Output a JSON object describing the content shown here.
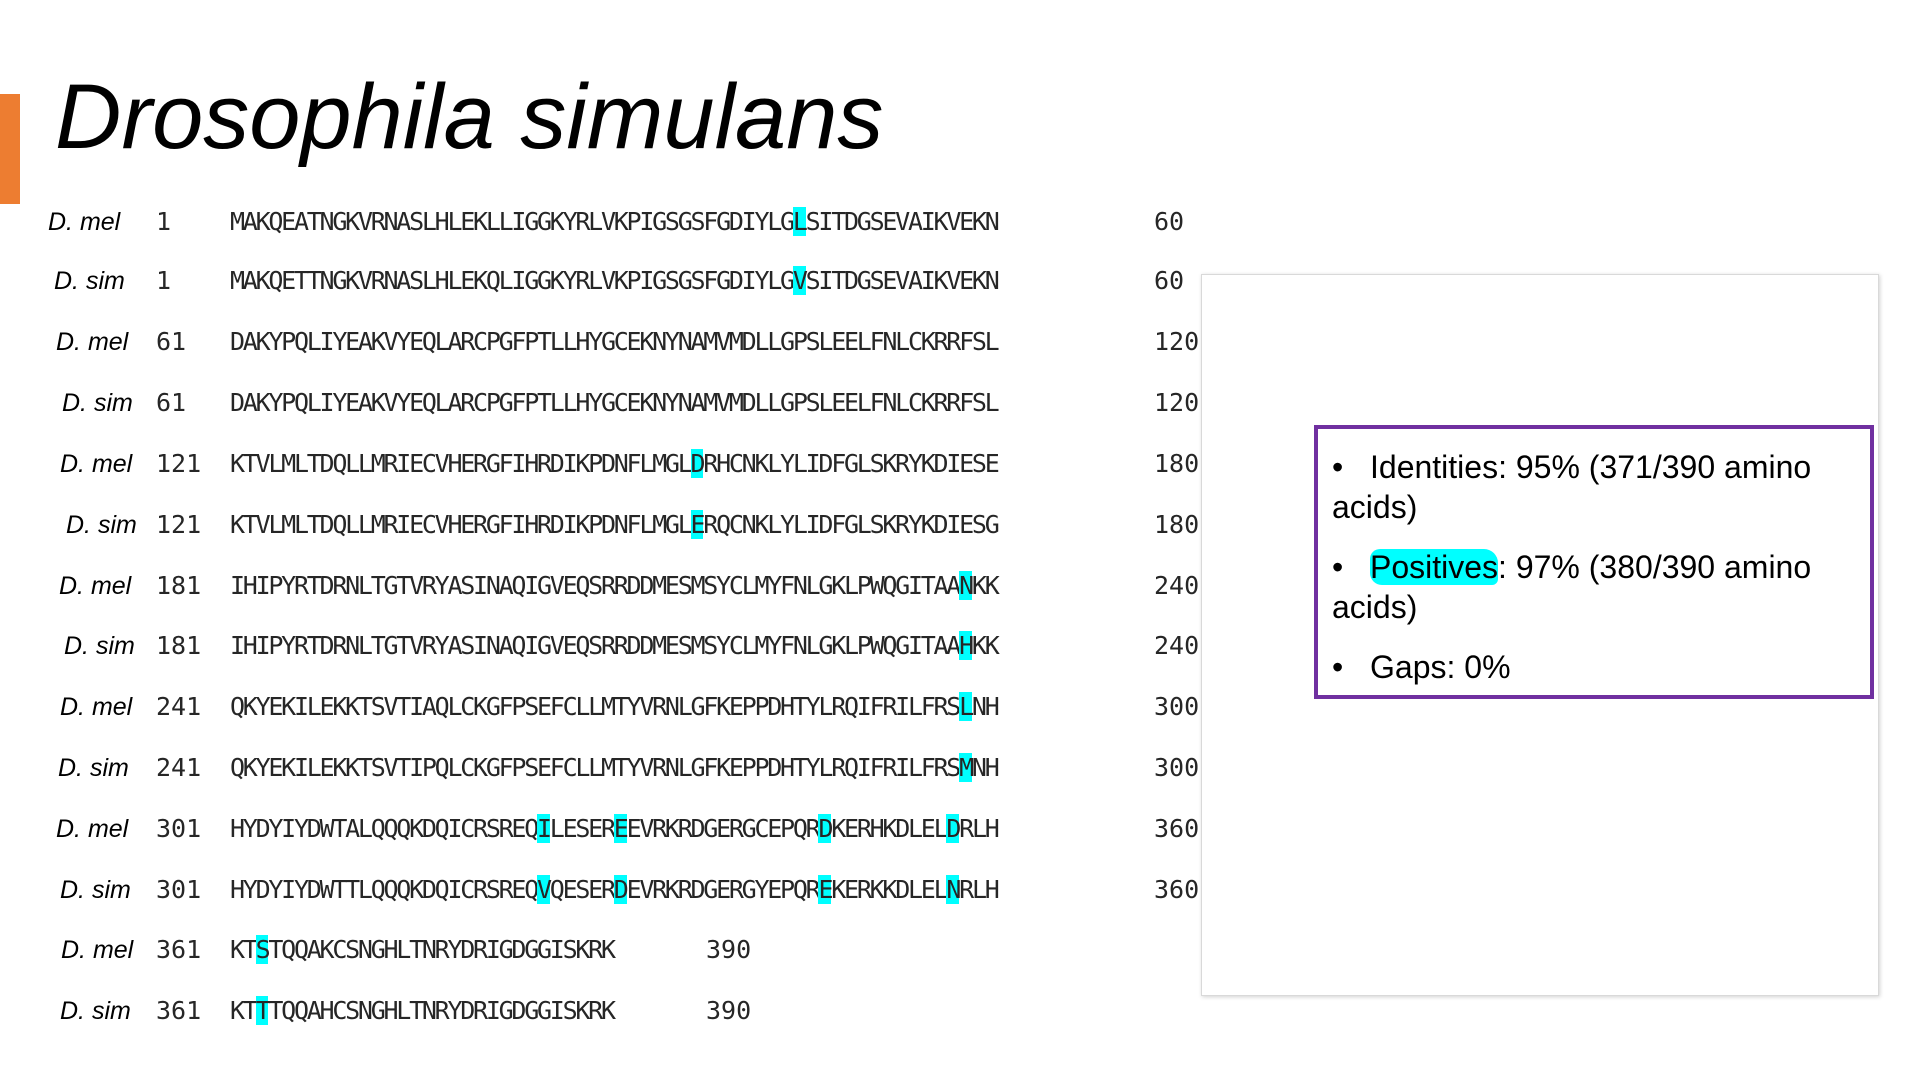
{
  "title": "Drosophila simulans",
  "alignment": [
    {
      "species": "D. mel",
      "start": "1",
      "end": "60",
      "segments": [
        {
          "t": "MAKQEATNGKVRNASLHLEKLLIGGKYRLVKPIGSGSFGDIYLG"
        },
        {
          "t": "L",
          "h": true
        },
        {
          "t": "SITDGSEVAIKVEKN"
        }
      ]
    },
    {
      "species": "D. sim",
      "start": "1",
      "end": "60",
      "segments": [
        {
          "t": "MAKQETTNGKVRNASLHLEKQLIGGKYRLVKPIGSGSFGDIYLG"
        },
        {
          "t": "V",
          "h": true
        },
        {
          "t": "SITDGSEVAIKVEKN"
        }
      ]
    },
    {
      "species": "D. mel",
      "start": "61",
      "end": "120",
      "segments": [
        {
          "t": "DAKYPQLIYEAKVYEQLARCPGFPTLLHYGCEKNYNAMVMDLLGPSLEELFNLCKRRFSL"
        }
      ]
    },
    {
      "species": "D. sim",
      "start": "61",
      "end": "120",
      "segments": [
        {
          "t": "DAKYPQLIYEAKVYEQLARCPGFPTLLHYGCEKNYNAMVMDLLGPSLEELFNLCKRRFSL"
        }
      ]
    },
    {
      "species": "D. mel",
      "start": "121",
      "end": "180",
      "segments": [
        {
          "t": "KTVLMLTDQLLMRIECVHERGFIHRDIKPDNFLMGL"
        },
        {
          "t": "D",
          "h": true
        },
        {
          "t": "RHCNKLYLIDFGLSKRYKDIESE"
        }
      ]
    },
    {
      "species": "D. sim",
      "start": "121",
      "end": "180",
      "segments": [
        {
          "t": "KTVLMLTDQLLMRIECVHERGFIHRDIKPDNFLMGL"
        },
        {
          "t": "E",
          "h": true
        },
        {
          "t": "RQCNKLYLIDFGLSKRYKDIESG"
        }
      ]
    },
    {
      "species": "D. mel",
      "start": "181",
      "end": "240",
      "segments": [
        {
          "t": "IHIPYRTDRNLTGTVRYASINAQIGVEQSRRDDMESMSYCLMYFNLGKLPWQGITAA"
        },
        {
          "t": "N",
          "h": true
        },
        {
          "t": "KK"
        }
      ]
    },
    {
      "species": "D. sim",
      "start": "181",
      "end": "240",
      "segments": [
        {
          "t": "IHIPYRTDRNLTGTVRYASINAQIGVEQSRRDDMESMSYCLMYFNLGKLPWQGITAA"
        },
        {
          "t": "H",
          "h": true
        },
        {
          "t": "KK"
        }
      ]
    },
    {
      "species": "D. mel",
      "start": "241",
      "end": "300",
      "segments": [
        {
          "t": "QKYEKILEKKTSVTIAQLCKGFPSEFCLLMTYVRNLGFKEPPDHTYLRQIFRILFRS"
        },
        {
          "t": "L",
          "h": true
        },
        {
          "t": "NH"
        }
      ]
    },
    {
      "species": "D. sim",
      "start": "241",
      "end": "300",
      "segments": [
        {
          "t": "QKYEKILEKKTSVTIPQLCKGFPSEFCLLMTYVRNLGFKEPPDHTYLRQIFRILFRS"
        },
        {
          "t": "M",
          "h": true
        },
        {
          "t": "NH"
        }
      ]
    },
    {
      "species": "D. mel",
      "start": "301",
      "end": "360",
      "segments": [
        {
          "t": "HYDYIYDWTALQQQKDQICRSREQ"
        },
        {
          "t": "I",
          "h": true
        },
        {
          "t": "LESER"
        },
        {
          "t": "E",
          "h": true
        },
        {
          "t": "EVRKRDGERGCEPQR"
        },
        {
          "t": "D",
          "h": true
        },
        {
          "t": "KERHKDLEL"
        },
        {
          "t": "D",
          "h": true
        },
        {
          "t": "RLH"
        }
      ]
    },
    {
      "species": "D. sim",
      "start": "301",
      "end": "360",
      "segments": [
        {
          "t": "HYDYIYDWTTLQQQKDQICRSREQ"
        },
        {
          "t": "V",
          "h": true
        },
        {
          "t": "QESER"
        },
        {
          "t": "D",
          "h": true
        },
        {
          "t": "EVRKRDGERGYEPQR"
        },
        {
          "t": "E",
          "h": true
        },
        {
          "t": "KERKKDLEL"
        },
        {
          "t": "N",
          "h": true
        },
        {
          "t": "RLH"
        }
      ]
    },
    {
      "species": "D. mel",
      "start": "361",
      "end": "390",
      "segments": [
        {
          "t": "KT"
        },
        {
          "t": "S",
          "h": true
        },
        {
          "t": "TQQAKCSNGHLTNRYDRIGDGGISKRK"
        }
      ]
    },
    {
      "species": "D. sim",
      "start": "361",
      "end": "390",
      "segments": [
        {
          "t": "KT"
        },
        {
          "t": "T",
          "h": true
        },
        {
          "t": "TQQAHCSNGHLTNRYDRIGDGGISKRK"
        }
      ]
    }
  ],
  "stats": [
    {
      "label": "Identities",
      "value": ": 95%  (371/390 amino acids)"
    },
    {
      "label": "Positives",
      "value": ": 97%  (380/390 amino acids)"
    },
    {
      "label": "Gaps",
      "value": ": 0%"
    }
  ],
  "colors": {
    "accent": "#ED7D31",
    "highlight": "#00FFFF",
    "box_border": "#7030A0"
  }
}
